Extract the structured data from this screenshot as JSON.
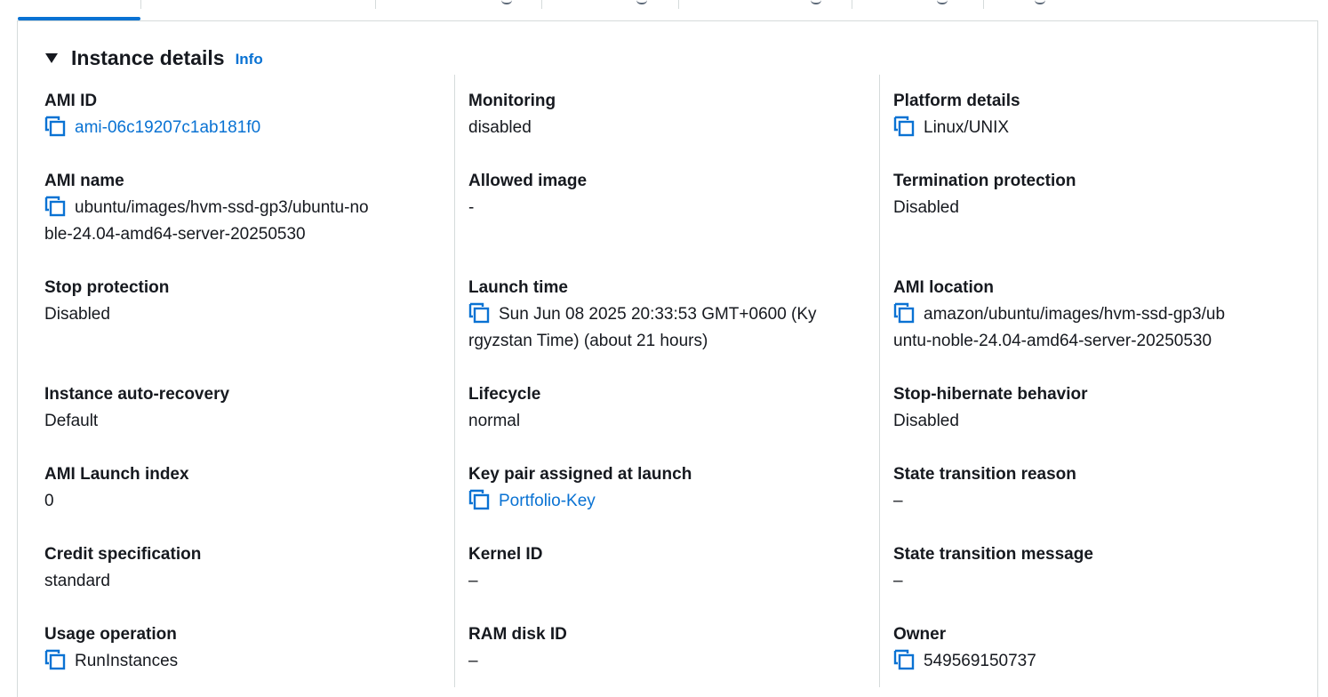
{
  "section": {
    "title": "Instance details",
    "info_link": "Info"
  },
  "columns": [
    [
      {
        "label": "AMI ID",
        "value": "ami-06c19207c1ab181f0",
        "copy": true,
        "link": true
      },
      {
        "label": "AMI name",
        "value": "ubuntu/images/hvm-ssd-gp3/ubuntu-no ble-24.04-amd64-server-20250530",
        "copy": true,
        "link": false
      },
      {
        "label": "Stop protection",
        "value": "Disabled"
      },
      {
        "label": "Instance auto-recovery",
        "value": "Default"
      },
      {
        "label": "AMI Launch index",
        "value": "0"
      },
      {
        "label": "Credit specification",
        "value": "standard"
      },
      {
        "label": "Usage operation",
        "value": "RunInstances",
        "copy": true,
        "link": false
      }
    ],
    [
      {
        "label": "Monitoring",
        "value": "disabled"
      },
      {
        "label": "Allowed image",
        "value": "-"
      },
      {
        "label": "Launch time",
        "value": "Sun Jun 08 2025 20:33:53 GMT+0600 (Ky rgyzstan Time) (about 21 hours)",
        "copy": true,
        "link": false
      },
      {
        "label": "Lifecycle",
        "value": "normal"
      },
      {
        "label": "Key pair assigned at launch",
        "value": "Portfolio-Key",
        "copy": true,
        "link": true
      },
      {
        "label": "Kernel ID",
        "value": "–"
      },
      {
        "label": "RAM disk ID",
        "value": "–"
      }
    ],
    [
      {
        "label": "Platform details",
        "value": "Linux/UNIX",
        "copy": true,
        "link": false
      },
      {
        "label": "Termination protection",
        "value": "Disabled"
      },
      {
        "label": "AMI location",
        "value": "amazon/ubuntu/images/hvm-ssd-gp3/ub untu-noble-24.04-amd64-server-20250530",
        "copy": true,
        "link": false
      },
      {
        "label": "Stop-hibernate behavior",
        "value": "Disabled"
      },
      {
        "label": "State transition reason",
        "value": "–"
      },
      {
        "label": "State transition message",
        "value": "–"
      },
      {
        "label": "Owner",
        "value": "549569150737",
        "copy": true,
        "link": false
      }
    ]
  ],
  "colors": {
    "link": "#0972d3",
    "text": "#16191f",
    "border": "#d5dbdb"
  }
}
